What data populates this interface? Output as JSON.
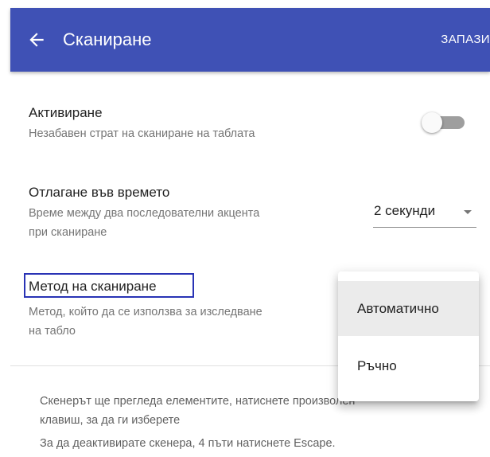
{
  "header": {
    "title": "Сканиране",
    "save_label": "ЗАПАЗИ",
    "back_icon": "arrow-left-icon",
    "color": "#3f51b5"
  },
  "activation": {
    "title": "Активиране",
    "description": "Незабавен страт на сканиране на таблата",
    "enabled": false
  },
  "delay": {
    "title": "Отлагане във времето",
    "description_line1": "Време между два последователни акцента",
    "description_line2": "при сканиране",
    "selected": "2 секунди"
  },
  "method": {
    "title": "Метод на сканиране",
    "description_line1": "Метод, който да се използва за изследване",
    "description_line2": "на табло",
    "highlight_color": "#2933b5",
    "options": [
      "Автоматично",
      "Ръчно"
    ],
    "highlighted_option": "Автоматично"
  },
  "info": {
    "line1": "Скенерът ще прегледа елементите, натиснете произволен",
    "line2": "клавиш, за да ги изберете",
    "line3": "За да деактивирате скенера, 4 пъти натиснете Escape."
  }
}
